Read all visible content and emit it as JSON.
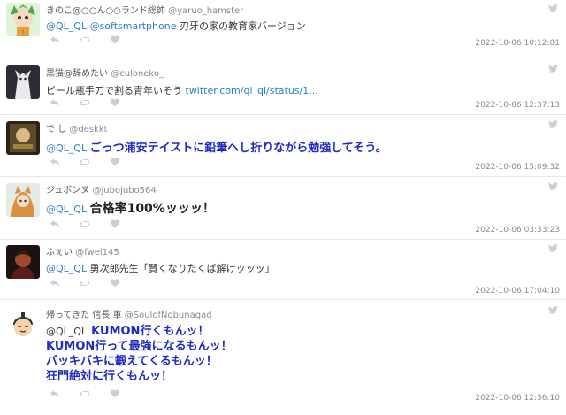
{
  "tweets": [
    {
      "display_name": "きのこ@○○ん○○ランド総帥",
      "screen_name": "@yaruo_hamster",
      "mentions": "@QL_QL @softsmartphone",
      "text": "刃牙の家の教育家バージョン",
      "timestamp": "2022-10-06 10:12:01"
    },
    {
      "display_name": "黒猫@辞めたい",
      "screen_name": "@culoneko_",
      "text": "ビール瓶手刀で割る青年いそう",
      "link": "twitter.com/ql_ql/status/1...",
      "timestamp": "2022-10-06 12:37:13"
    },
    {
      "display_name": "で し",
      "screen_name": "@deskkt",
      "mentions": "@QL_QL",
      "text": "ごっつ浦安テイストに鉛筆へし折りながら勉強してそう。",
      "timestamp": "2022-10-06 15:09:32"
    },
    {
      "display_name": "ジュボンヌ",
      "screen_name": "@jubojubo564",
      "mentions": "@QL_QL",
      "text": "合格率100%ッッッ！",
      "timestamp": "2022-10-06 03:33:23"
    },
    {
      "display_name": "ふぇい",
      "screen_name": "@fwei145",
      "mentions": "@QL_QL",
      "text": "勇次郎先生「賢くなりたくば解けッッッ」",
      "timestamp": "2022-10-06 17:04:10"
    },
    {
      "display_name": "帰ってきた 信長 軍",
      "screen_name": "@SoulofNobunagad",
      "mentions": "@QL_QL",
      "lines": [
        "KUMON行くもんッ！",
        "KUMON行って最強になるもんッ！",
        "バッキバキに鍛えてくるもんッ！",
        "狂門絶対に行くもんッ！"
      ],
      "timestamp": "2022-10-06 12:36:10"
    }
  ],
  "icons": {
    "reply": "reply-icon",
    "retweet": "retweet-icon",
    "like": "heart-icon",
    "twitter": "twitter-bird-icon"
  },
  "colors": {
    "mention": "#2c7ccd",
    "emphasis": "#1c2bc4",
    "icon": "#c8d0d6"
  }
}
